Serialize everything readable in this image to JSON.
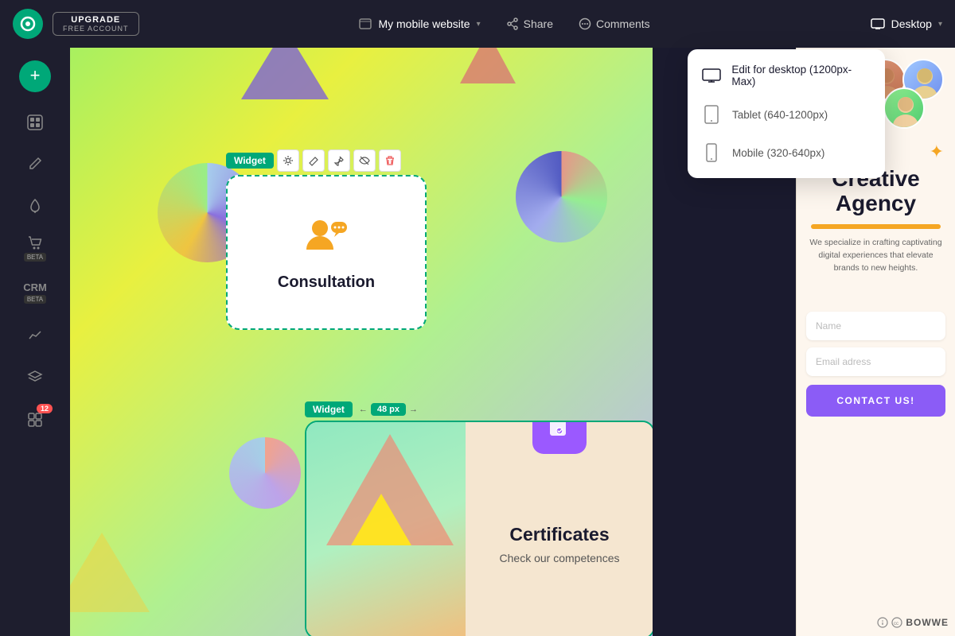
{
  "topbar": {
    "logo_label": "BOWWE logo",
    "upgrade_label": "UPGRADE",
    "free_account_label": "FREE ACCOUNT",
    "site_name": "My mobile website",
    "share_label": "Share",
    "comments_label": "Comments",
    "desktop_label": "Desktop"
  },
  "sidebar": {
    "add_btn_label": "+",
    "items": [
      {
        "id": "pages",
        "icon": "▣",
        "label": ""
      },
      {
        "id": "edit",
        "icon": "✏",
        "label": ""
      },
      {
        "id": "pen",
        "icon": "🖊",
        "label": ""
      },
      {
        "id": "cart",
        "icon": "🛒",
        "label": "BETA"
      },
      {
        "id": "crm",
        "icon": "CRM",
        "label": "BETA"
      },
      {
        "id": "analytics",
        "icon": "📈",
        "label": ""
      },
      {
        "id": "layers",
        "icon": "⊞",
        "label": ""
      },
      {
        "id": "apps",
        "icon": "⊡",
        "label": "12"
      }
    ]
  },
  "widget1": {
    "label": "Widget",
    "title": "Consultation",
    "icon": "👥"
  },
  "widget2": {
    "label": "Widget",
    "px_label": "48 px",
    "title": "Certificates",
    "subtitle": "Check our competences"
  },
  "preview": {
    "title_line1": "Creative",
    "title_line2": "Agency",
    "description": "We specialize in crafting captivating digital experiences that elevate brands to new heights.",
    "name_placeholder": "Name",
    "email_placeholder": "Email adress",
    "cta_label": "CONTACT US!",
    "footer_label": "BOWWE"
  },
  "dropdown": {
    "items": [
      {
        "id": "desktop",
        "label": "Edit for desktop (1200px-Max)",
        "active": true
      },
      {
        "id": "tablet",
        "label": "Tablet (640-1200px)",
        "active": false
      },
      {
        "id": "mobile",
        "label": "Mobile (320-640px)",
        "active": false
      }
    ]
  }
}
